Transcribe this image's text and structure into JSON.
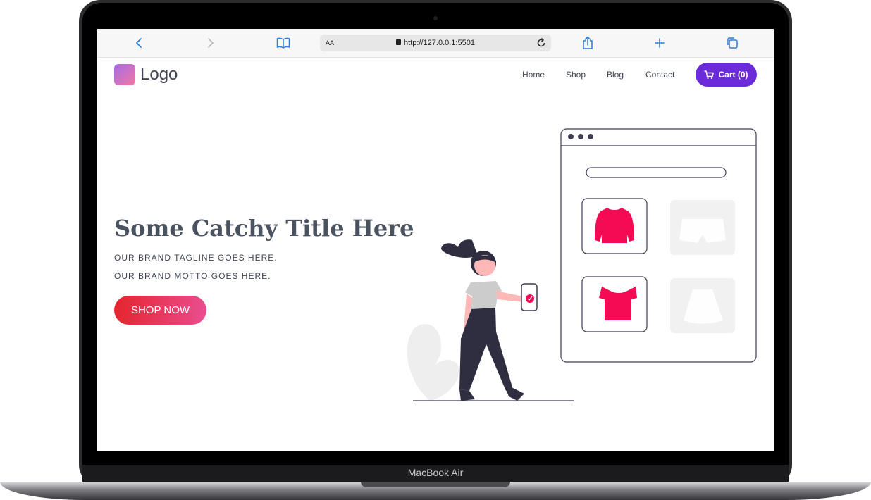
{
  "device": {
    "label": "MacBook Air"
  },
  "browser": {
    "address_prefix": "AA",
    "url": "http://127.0.0.1:5501",
    "icons": [
      "back-chevron-icon",
      "forward-chevron-icon",
      "bookmarks-book-icon",
      "lock-icon",
      "reload-icon",
      "share-icon",
      "new-tab-plus-icon",
      "tabs-icon"
    ]
  },
  "header": {
    "logo": "Logo",
    "nav": [
      "Home",
      "Shop",
      "Blog",
      "Contact"
    ],
    "cart_label": "Cart (0)"
  },
  "hero": {
    "title": "Some Catchy Title Here",
    "tagline": "OUR BRAND TAGLINE GOES HERE.",
    "motto": "OUR BRAND MOTTO GOES HERE.",
    "cta": "SHOP NOW"
  },
  "colors": {
    "accent_purple": "#6c2bd9",
    "cta_gradient_start": "#e4252e",
    "cta_gradient_end": "#ea4d8f",
    "product_pink": "#f50a54",
    "text_dark": "#3e4452"
  }
}
